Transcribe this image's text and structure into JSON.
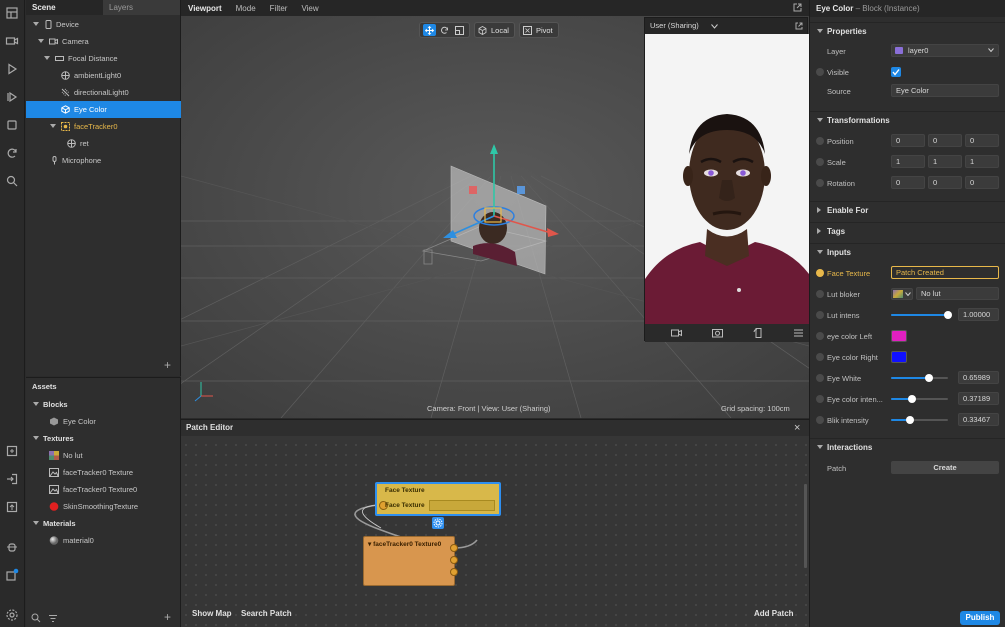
{
  "rail": {
    "icons": [
      "layout-icon",
      "camera-icon",
      "play-icon",
      "video-play-icon",
      "stop-icon",
      "refresh-icon",
      "search-icon",
      "add-file-icon",
      "login-icon",
      "export-icon",
      "bug-icon",
      "notifications-icon",
      "settings-icon"
    ]
  },
  "scene": {
    "tab_scene": "Scene",
    "tab_layers": "Layers",
    "items": [
      {
        "label": "Device",
        "icon": "device-icon"
      },
      {
        "label": "Camera",
        "icon": "camera-icon"
      },
      {
        "label": "Focal Distance",
        "icon": "focal-distance-icon"
      },
      {
        "label": "ambientLight0",
        "icon": "ambient-light-icon"
      },
      {
        "label": "directionalLight0",
        "icon": "directional-light-icon"
      },
      {
        "label": "Eye Color",
        "icon": "block-icon"
      },
      {
        "label": "faceTracker0",
        "icon": "face-tracker-icon"
      },
      {
        "label": "ret",
        "icon": "planar-object-icon"
      },
      {
        "label": "Microphone",
        "icon": "microphone-icon"
      }
    ],
    "add_symbol": "+"
  },
  "assets": {
    "title": "Assets",
    "groups": {
      "blocks": "Blocks",
      "textures": "Textures",
      "materials": "Materials"
    },
    "items": {
      "eye_color": "Eye Color",
      "no_lut": "No lut",
      "face_tracker_texture": "faceTracker0 Texture",
      "face_tracker_texture0": "faceTracker0 Texture0",
      "skin_smoothing": "SkinSmoothingTexture",
      "material0": "material0"
    },
    "add_symbol": "+"
  },
  "viewport": {
    "menu": [
      "Viewport",
      "Mode",
      "Filter",
      "View"
    ],
    "tool_local": "Local",
    "tool_pivot": "Pivot",
    "status": "Camera: Front | View: User (Sharing)",
    "grid_spacing": "Grid spacing: 100cm"
  },
  "preview": {
    "title": "User (Sharing)"
  },
  "patch_editor": {
    "title": "Patch Editor",
    "close_symbol": "×",
    "node_face_texture_title": "Face Texture",
    "node_face_texture_port": "Face Texture",
    "node_tracker_title": "faceTracker0 Texture0",
    "show_map": "Show Map",
    "search_patch": "Search Patch",
    "add_patch": "Add Patch"
  },
  "inspector": {
    "title": "Eye Color",
    "subtitle": "– Block (Instance)",
    "sections": {
      "properties": "Properties",
      "transformations": "Transformations",
      "enable_for": "Enable For",
      "tags": "Tags",
      "inputs": "Inputs",
      "interactions": "Interactions"
    },
    "layer_label": "Layer",
    "layer_value": "layer0",
    "visible_label": "Visible",
    "source_label": "Source",
    "source_value": "Eye Color",
    "position_label": "Position",
    "position": [
      "0",
      "0",
      "0"
    ],
    "scale_label": "Scale",
    "scale": [
      "1",
      "1",
      "1"
    ],
    "rotation_label": "Rotation",
    "rotation": [
      "0",
      "0",
      "0"
    ],
    "face_texture_label": "Face Texture",
    "face_texture_value": "Patch Created",
    "lut_blocker_label": "Lut bloker",
    "lut_blocker_value": "No lut",
    "lut_intens_label": "Lut intens",
    "lut_intens_value": "1.00000",
    "lut_intens_level": 1.0,
    "eye_color_left_label": "eye color Left",
    "eye_color_left": "#e020c0",
    "eye_color_right_label": "Eye color Right",
    "eye_color_right": "#1010ff",
    "eye_white_label": "Eye White",
    "eye_white_value": "0.65989",
    "eye_white_level": 0.66,
    "eye_color_inten_label": "Eye color inten...",
    "eye_color_inten_value": "0.37189",
    "eye_color_inten_level": 0.37,
    "blik_label": "Blik intensity",
    "blik_value": "0.33467",
    "blik_level": 0.33,
    "patch_label": "Patch",
    "create_button": "Create",
    "publish_button": "Publish"
  }
}
